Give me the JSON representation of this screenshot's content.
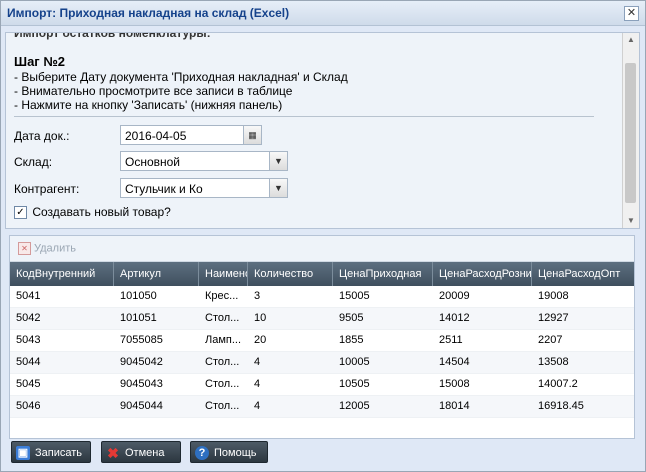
{
  "window": {
    "title": "Импорт: Приходная накладная на склад (Excel)",
    "close_glyph": "✕"
  },
  "form": {
    "cut_text": "Импорт остатков номенклатуры:",
    "step_title": "Шаг №2",
    "steps": [
      "- Выберите Дату документа 'Приходная накладная' и Склад",
      "- Внимательно просмотрите все записи в таблице",
      "- Нажмите на кнопку 'Записать' (нижняя панель)"
    ],
    "date_label": "Дата док.:",
    "date_value": "2016-04-05",
    "warehouse_label": "Склад:",
    "warehouse_value": "Основной",
    "counterparty_label": "Контрагент:",
    "counterparty_value": "Стульчик и Ко",
    "create_new_label": "Создавать новый товар?",
    "create_new_checked": true
  },
  "grid": {
    "delete_label": "Удалить",
    "columns": [
      "КодВнутренний",
      "Артикул",
      "Наименование",
      "Количество",
      "ЦенаПриходная",
      "ЦенаРасходРозница",
      "ЦенаРасходОпт"
    ],
    "rows": [
      [
        "5041",
        "101050",
        "Крес...",
        "3",
        "15005",
        "20009",
        "19008"
      ],
      [
        "5042",
        "101051",
        "Стол...",
        "10",
        "9505",
        "14012",
        "12927"
      ],
      [
        "5043",
        "7055085",
        "Ламп...",
        "20",
        "1855",
        "2511",
        "2207"
      ],
      [
        "5044",
        "9045042",
        "Стол...",
        "4",
        "10005",
        "14504",
        "13508"
      ],
      [
        "5045",
        "9045043",
        "Стол...",
        "4",
        "10505",
        "15008",
        "14007.2"
      ],
      [
        "5046",
        "9045044",
        "Стол...",
        "4",
        "12005",
        "18014",
        "16918.45"
      ]
    ]
  },
  "buttons": {
    "save": "Записать",
    "cancel": "Отмена",
    "help": "Помощь"
  },
  "colors": {
    "header_bg": "#4a5b6a",
    "title_text": "#15428b",
    "save_icon": "#3b7dd8",
    "cancel_icon": "#d32f2f",
    "help_icon": "#2e6fc0"
  }
}
